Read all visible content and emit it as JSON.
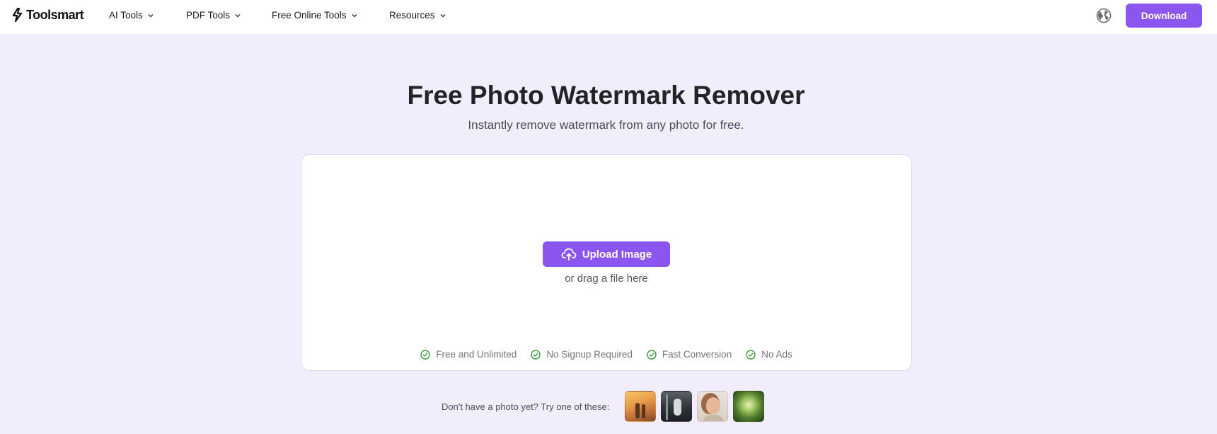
{
  "header": {
    "logo_text": "Toolsmart",
    "nav": [
      {
        "label": "AI Tools"
      },
      {
        "label": "PDF Tools"
      },
      {
        "label": "Free Online Tools"
      },
      {
        "label": "Resources"
      }
    ],
    "download_label": "Download",
    "icons": {
      "logo": "bolt-logo-icon",
      "language": "globe-icon",
      "dropdown": "chevron-down-icon"
    }
  },
  "hero": {
    "title": "Free Photo Watermark Remover",
    "subtitle": "Instantly remove watermark from any photo for free."
  },
  "upload": {
    "button_label": "Upload Image",
    "drag_text": "or drag a file here",
    "upload_icon": "cloud-upload-icon"
  },
  "features": [
    {
      "label": "Free and Unlimited"
    },
    {
      "label": "No Signup Required"
    },
    {
      "label": "Fast Conversion"
    },
    {
      "label": "No Ads"
    }
  ],
  "samples": {
    "label": "Don't have a photo yet? Try one of these:",
    "items": [
      {
        "name": "sample-sunset-couple"
      },
      {
        "name": "sample-car-door"
      },
      {
        "name": "sample-portrait"
      },
      {
        "name": "sample-forest"
      }
    ]
  },
  "colors": {
    "accent": "#8b55f0",
    "page_background": "#f1edfc",
    "check_green": "#3e9a3c"
  }
}
